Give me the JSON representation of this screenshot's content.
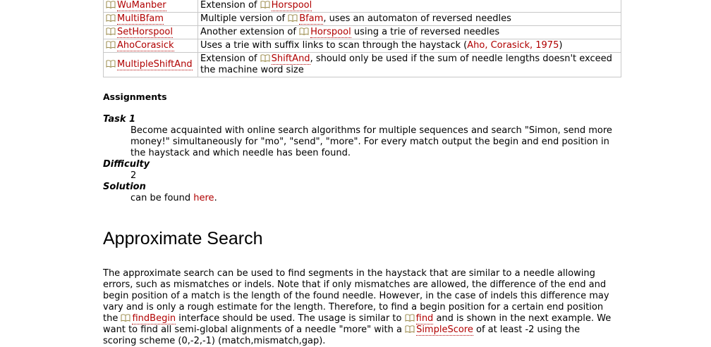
{
  "algo_table": {
    "rows": [
      {
        "name": "WuManber",
        "d1": "Extension of ",
        "link1": "Horspool",
        "d2": "",
        "link2": "",
        "d3": ""
      },
      {
        "name": "MultiBfam",
        "d1": "Multiple version of ",
        "link1": "Bfam",
        "d2": ", uses an automaton of reversed needles",
        "link2": "",
        "d3": ""
      },
      {
        "name": "SetHorspool",
        "d1": "Another extension of ",
        "link1": "Horspool",
        "d2": " using a trie of reversed needles",
        "link2": "",
        "d3": ""
      },
      {
        "name": "AhoCorasick",
        "d1": "Uses a trie with suffix links to scan through the haystack (",
        "link1": "",
        "d2": "",
        "link2": "Aho, Corasick, 1975",
        "d3": ")"
      },
      {
        "name": "MultipleShiftAnd",
        "d1": "Extension of ",
        "link1": "ShiftAnd",
        "d2": ", should only be used if the sum of needle lengths doesn't exceed the machine word size",
        "link2": "",
        "d3": ""
      }
    ]
  },
  "assignments": {
    "title": "Assignments",
    "task_label": "Task 1",
    "task_text": "Become acquainted with online search algorithms for multiple sequences and search \"Simon, send more money!\" simultaneously for \"mo\", \"send\", \"more\". For every match output the begin and end position in the haystack and which needle has been found.",
    "difficulty_label": "Difficulty",
    "difficulty_value": "2",
    "solution_label": "Solution",
    "solution_pre": "can be found ",
    "solution_link": "here",
    "solution_post": "."
  },
  "approx": {
    "heading": "Approximate Search",
    "p1": "The approximate search can be used to find segments in the haystack that are similar to a needle allowing errors, such as mismatches or indels. Note that if only mismatches are allowed, the difference of the end and begin position of a match is the length of the found needle. However, in the case of indels this difference may vary and is only a rough estimate for the length. Therefore, to find a begin position for a certain end position the ",
    "link_findbegin": "findBegin",
    "p2": " interface should be used. The usage is similar to ",
    "link_find": "find",
    "p3": " and is shown in the next example. We want to find all semi-global alignments of a needle \"more\" with a ",
    "link_simplescore": "SimpleScore",
    "p4": " of at least -2 using the scoring scheme (0,-2,-1) (match,mismatch,gap)."
  },
  "icons": {
    "doc_link": "book-icon"
  },
  "colors": {
    "link": "#b00000",
    "table_border": "#c8c8c8"
  }
}
